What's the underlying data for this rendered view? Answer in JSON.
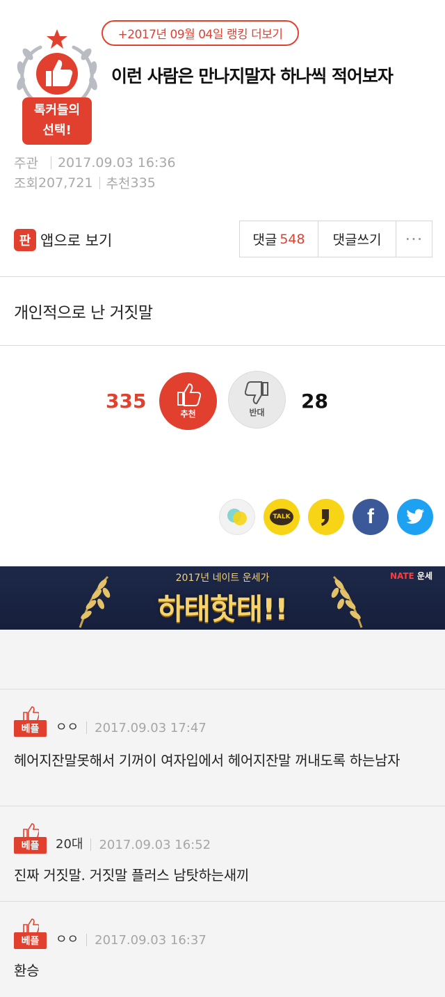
{
  "header": {
    "badge_text_line1": "톡커들의",
    "badge_text_line2": "선택!",
    "ranking_link": "+2017년 09월 04일 랭킹 더보기",
    "title": "이런 사람은 만나지말자 하나씩 적어보자"
  },
  "meta": {
    "category": "주관",
    "datetime": "2017.09.03 16:36",
    "views_label": "조회",
    "views": "207,721",
    "recommend_label": "추천",
    "recommend": "335"
  },
  "toolbar": {
    "app_icon_glyph": "판",
    "app_view_label": "앱으로 보기",
    "comments_label": "댓글",
    "comments_count": "548",
    "write_comment_label": "댓글쓰기",
    "more_label": "···"
  },
  "post": {
    "body": "개인적으로 난 거짓말"
  },
  "votes": {
    "up_count": "335",
    "up_label": "추천",
    "down_count": "28",
    "down_label": "반대"
  },
  "share": {
    "icons": [
      "nate-icon",
      "kakaotalk-icon",
      "kakaostory-icon",
      "facebook-icon",
      "twitter-icon"
    ],
    "kakaotalk_text": "TALK",
    "facebook_glyph": "f"
  },
  "banner": {
    "subtitle": "2017년 네이트 운세가",
    "title": "하태핫태!!",
    "brand_nate": "NATE",
    "brand_suffix": "운세"
  },
  "comments": [
    {
      "badge": "베플",
      "author": "ㅇㅇ",
      "time": "2017.09.03 17:47",
      "text": "헤어지잔말못해서 기꺼이 여자입에서 헤어지잔말 꺼내도록 하는남자"
    },
    {
      "badge": "베플",
      "author": "20대",
      "time": "2017.09.03 16:52",
      "text": "진짜 거짓말. 거짓말 플러스 남탓하는새끼"
    },
    {
      "badge": "베플",
      "author": "ㅇㅇ",
      "time": "2017.09.03 16:37",
      "text": "환승"
    }
  ],
  "colors": {
    "accent": "#e2402f",
    "banner_bg": "#1d2848",
    "kakao_yellow": "#f7d516",
    "facebook": "#3b5998",
    "twitter": "#1da1f2"
  }
}
